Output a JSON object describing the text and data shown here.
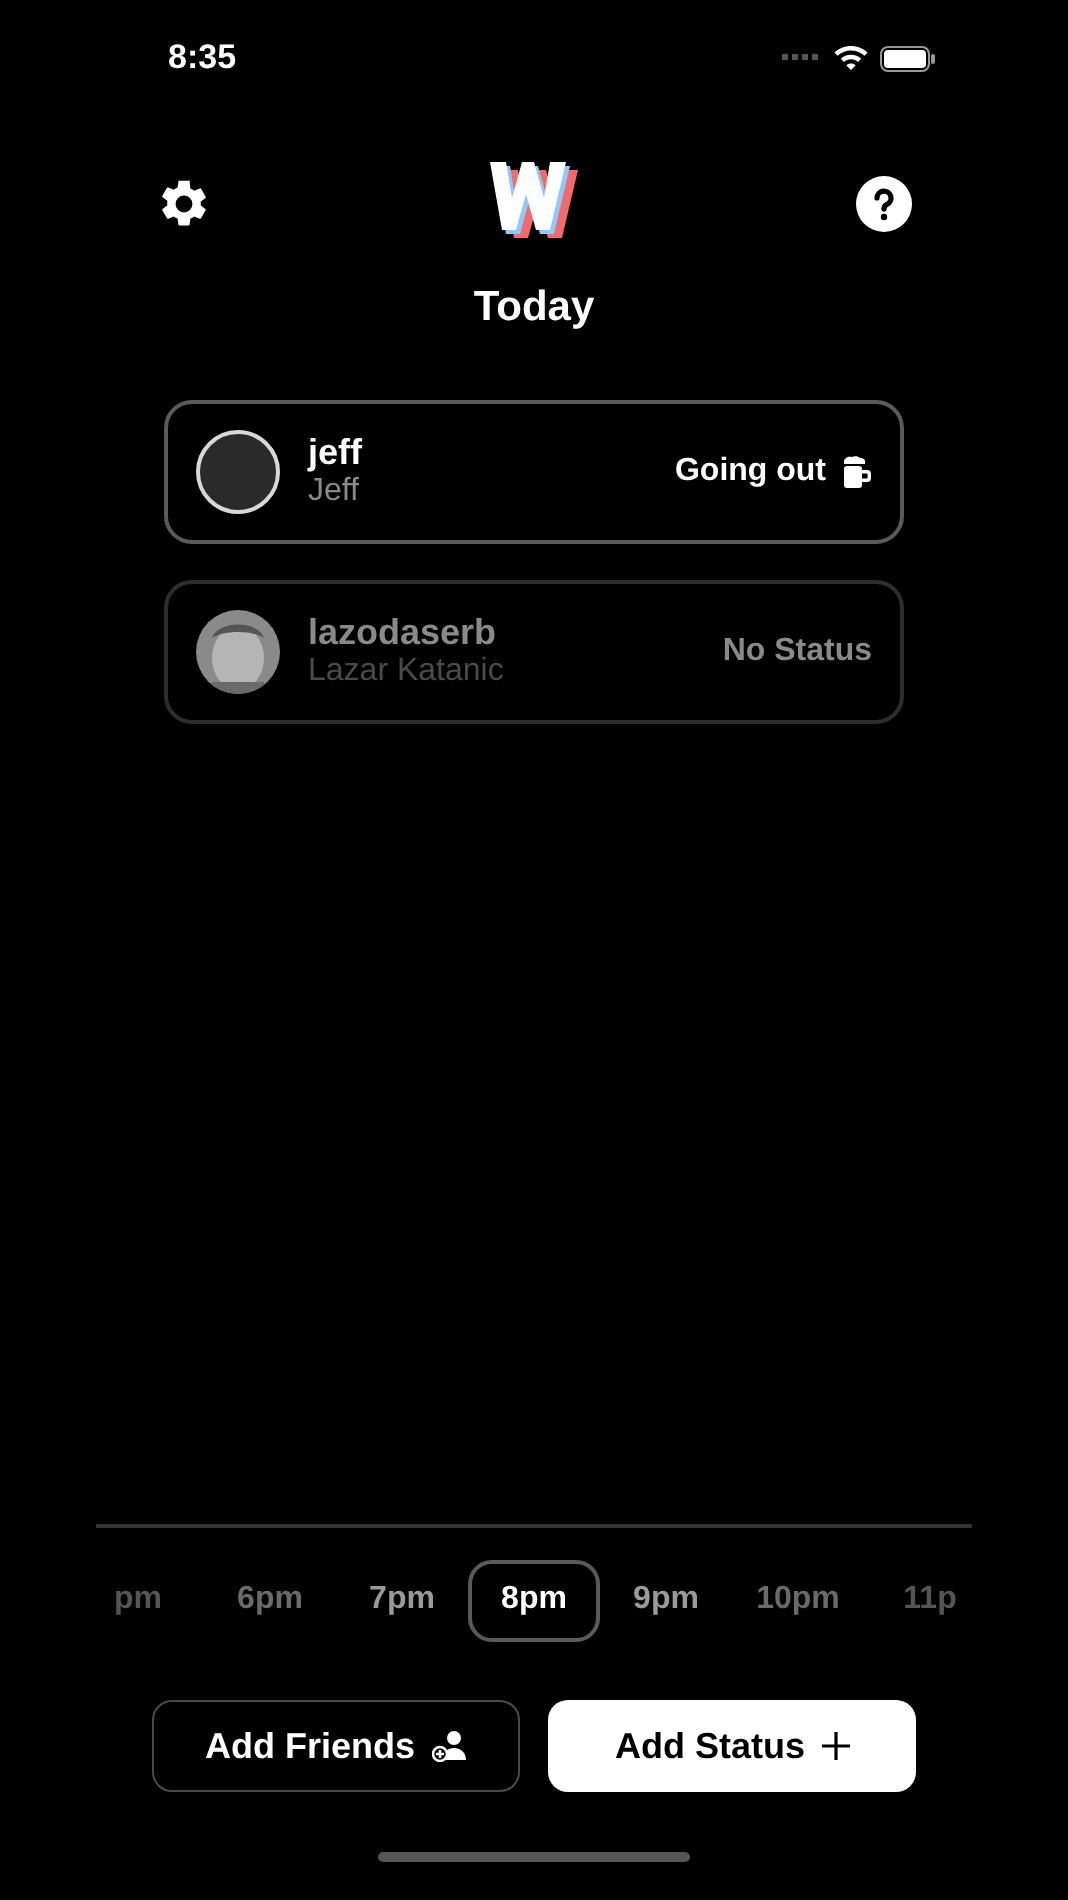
{
  "status_bar": {
    "time": "8:35"
  },
  "header": {
    "title": "Today"
  },
  "friends": [
    {
      "username": "jeff",
      "name": "Jeff",
      "avatar": {
        "kind": "empty"
      },
      "active": true,
      "status": "Going out",
      "has_icon": true
    },
    {
      "username": "lazodaserb",
      "name": "Lazar Katanic",
      "active": false,
      "status": "No Status",
      "has_icon": false
    }
  ],
  "times": [
    {
      "label": "pm",
      "selected": false
    },
    {
      "label": "6pm",
      "selected": false
    },
    {
      "label": "7pm",
      "selected": false
    },
    {
      "label": "8pm",
      "selected": true
    },
    {
      "label": "9pm",
      "selected": false
    },
    {
      "label": "10pm",
      "selected": false
    },
    {
      "label": "11p",
      "selected": false
    }
  ],
  "buttons": [
    {
      "label": "Add Friends",
      "kind": "outline"
    },
    {
      "label": "Add Status",
      "kind": "filled"
    }
  ]
}
